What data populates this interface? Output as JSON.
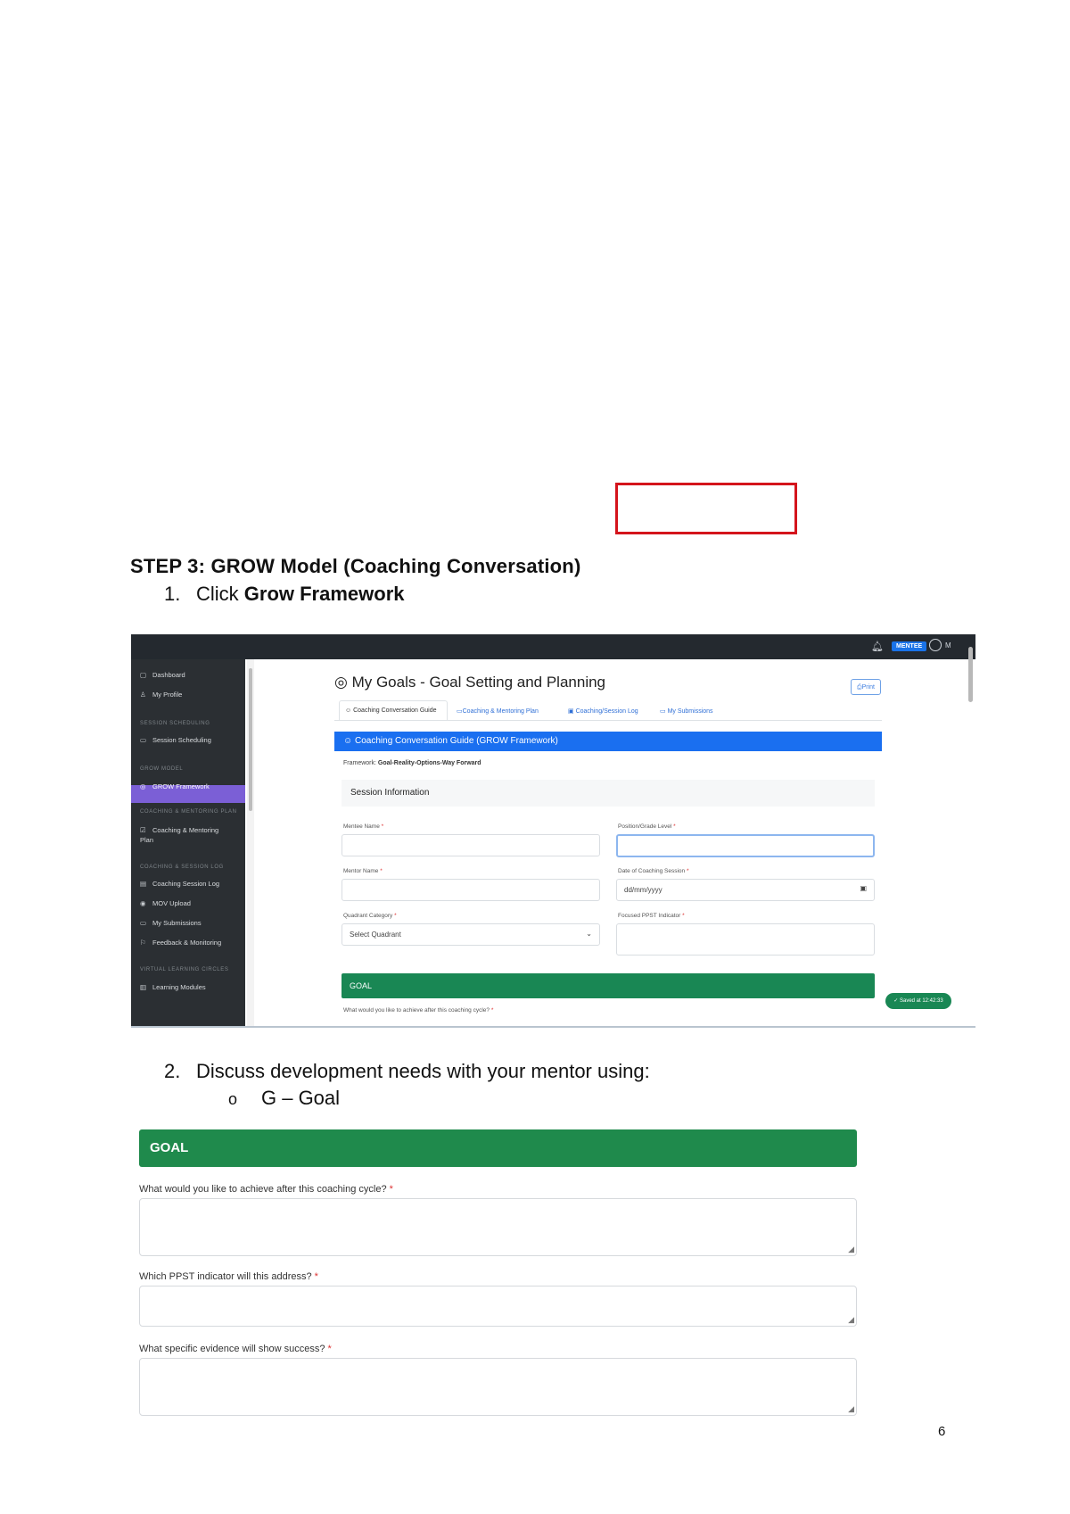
{
  "document": {
    "heading": "STEP 3: GROW Model (Coaching Conversation)",
    "step1": {
      "number": "1.",
      "text_prefix": "Click ",
      "text_bold": "Grow Framework"
    },
    "step2": {
      "number": "2.",
      "text": "Discuss development needs with your mentor using:"
    },
    "sub_bullet": {
      "bullet": "o",
      "text": "G – Goal"
    },
    "page_number": "6",
    "annotation_color": "#d4141c"
  },
  "screenshot": {
    "topbar": {
      "badge": "MENTEE",
      "user": "M"
    },
    "sidebar": {
      "items": [
        {
          "icon": "dashboard-icon",
          "glyph": "▢",
          "label": "Dashboard"
        },
        {
          "icon": "user-icon",
          "glyph": "♙",
          "label": "My Profile"
        },
        {
          "section": "SESSION SCHEDULING"
        },
        {
          "icon": "calendar-icon",
          "glyph": "▭",
          "label": "Session Scheduling"
        },
        {
          "section": "GROW MODEL"
        },
        {
          "icon": "target-icon",
          "glyph": "◎",
          "label": "GROW Framework",
          "active": true
        },
        {
          "section": "COACHING & MENTORING PLAN"
        },
        {
          "icon": "plan-icon",
          "glyph": "☑",
          "label": "Coaching & Mentoring Plan"
        },
        {
          "section": "COACHING & SESSION LOG"
        },
        {
          "icon": "log-icon",
          "glyph": "▤",
          "label": "Coaching Session Log"
        },
        {
          "icon": "upload-icon",
          "glyph": "◉",
          "label": "MOV Upload"
        },
        {
          "icon": "submissions-icon",
          "glyph": "▭",
          "label": "My Submissions"
        },
        {
          "icon": "feedback-icon",
          "glyph": "⚐",
          "label": "Feedback & Monitoring"
        },
        {
          "section": "VIRTUAL LEARNING CIRCLES"
        },
        {
          "icon": "modules-icon",
          "glyph": "▥",
          "label": "Learning Modules"
        }
      ],
      "active_color": "#7b5fd6"
    },
    "page_title": "My Goals - Goal Setting and Planning",
    "print_label": "Print",
    "tabs": [
      {
        "label": "Coaching Conversation Guide",
        "active": true
      },
      {
        "label": "Coaching & Mentoring Plan"
      },
      {
        "label": "Coaching/Session Log"
      },
      {
        "label": "My Submissions"
      }
    ],
    "banner": "Coaching Conversation Guide (GROW Framework)",
    "banner_color": "#1a6ff0",
    "framework_label": "Framework: ",
    "framework_value": "Goal-Reality-Options-Way Forward",
    "section_title": "Session Information",
    "fields": {
      "mentee_name": "Mentee Name",
      "position": "Position/Grade Level",
      "mentor_name": "Mentor Name",
      "date": "Date of Coaching Session",
      "date_placeholder": "dd/mm/yyyy",
      "quadrant": "Quadrant Category",
      "quadrant_value": "Select Quadrant",
      "indicator": "Focused PPST Indicator"
    },
    "goal_label": "GOAL",
    "goal_color": "#198754",
    "goal_question": "What would you like to achieve after this coaching cycle?",
    "saved": "Saved at 12:42:33"
  },
  "goal_panel": {
    "title": "GOAL",
    "q1": "What would you like to achieve after this coaching cycle?",
    "q2": "Which PPST indicator will this address?",
    "q3": "What specific evidence will show success?"
  }
}
